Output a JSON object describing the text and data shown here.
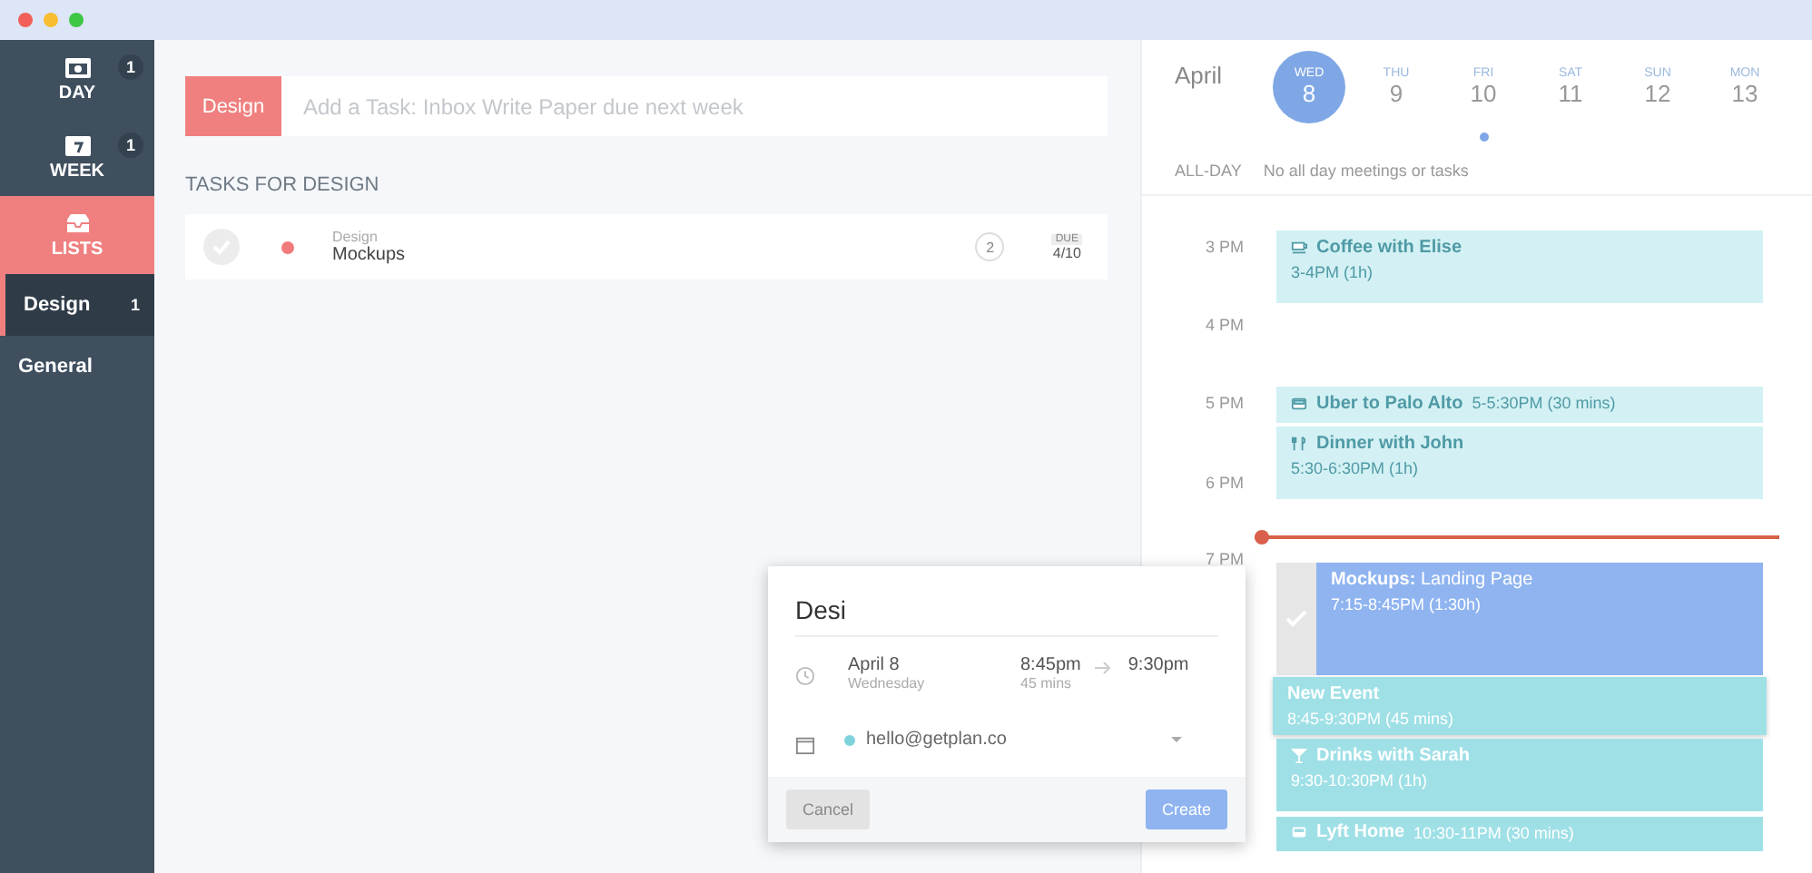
{
  "sidebar": {
    "nav": [
      {
        "label": "DAY",
        "count": "1",
        "kind": "day",
        "selected": false
      },
      {
        "label": "WEEK",
        "count": "1",
        "kind": "week",
        "selected": false
      },
      {
        "label": "LISTS",
        "kind": "lists",
        "selected": true
      }
    ],
    "lists": [
      {
        "label": "Design",
        "count": "1",
        "selected": true
      },
      {
        "label": "General",
        "selected": false
      }
    ]
  },
  "task_input": {
    "tag": "Design",
    "placeholder": "Add a Task: Inbox Write Paper due next week"
  },
  "tasks_heading": "TASKS FOR DESIGN",
  "tasks": [
    {
      "list": "Design",
      "title": "Mockups",
      "done": false,
      "color": "#f07b7b",
      "subtasks": "2",
      "due_label": "DUE",
      "due": "4/10"
    }
  ],
  "calendar": {
    "month": "April",
    "days": [
      {
        "weekday": "WED",
        "date": "8",
        "selected": true,
        "has_events": false
      },
      {
        "weekday": "THU",
        "date": "9",
        "selected": false,
        "has_events": false
      },
      {
        "weekday": "FRI",
        "date": "10",
        "selected": false,
        "has_events": true
      },
      {
        "weekday": "SAT",
        "date": "11",
        "selected": false,
        "has_events": false
      },
      {
        "weekday": "SUN",
        "date": "12",
        "selected": false,
        "has_events": false
      },
      {
        "weekday": "MON",
        "date": "13",
        "selected": false,
        "has_events": false
      }
    ],
    "all_day_label": "ALL-DAY",
    "all_day_text": "No all day meetings or tasks",
    "hours": [
      "3 PM",
      "4 PM",
      "5 PM",
      "6 PM",
      "7 PM"
    ],
    "events": [
      {
        "kind": "coffee",
        "title": "Coffee with Elise",
        "time": "3-4PM (1h)",
        "past": true
      },
      {
        "kind": "car",
        "title": "Uber to Palo Alto",
        "time": "5-5:30PM (30 mins)",
        "past": true
      },
      {
        "kind": "dining",
        "title": "Dinner with John",
        "time": "5:30-6:30PM (1h)",
        "past": true
      },
      {
        "kind": "task",
        "title": "**Mockups:** Landing Page",
        "time": "7:15-8:45PM (1:30h)",
        "past": false
      },
      {
        "kind": "new",
        "title": "New Event",
        "time": "8:45-9:30PM (45 mins)",
        "past": false
      },
      {
        "kind": "drink",
        "title": "Drinks with Sarah",
        "time": "9:30-10:30PM (1h)",
        "past": false
      },
      {
        "kind": "car",
        "title": "Lyft Home",
        "time": "10:30-11PM (30 mins)",
        "past": false
      }
    ]
  },
  "popup": {
    "title_value": "Desi",
    "date": "April 8",
    "weekday": "Wednesday",
    "start": "8:45pm",
    "end": "9:30pm",
    "duration": "45 mins",
    "calendar": "hello@getplan.co",
    "cancel": {
      "label": "Cancel",
      "disabled": true
    },
    "create": {
      "label": "Create",
      "disabled": false
    }
  }
}
